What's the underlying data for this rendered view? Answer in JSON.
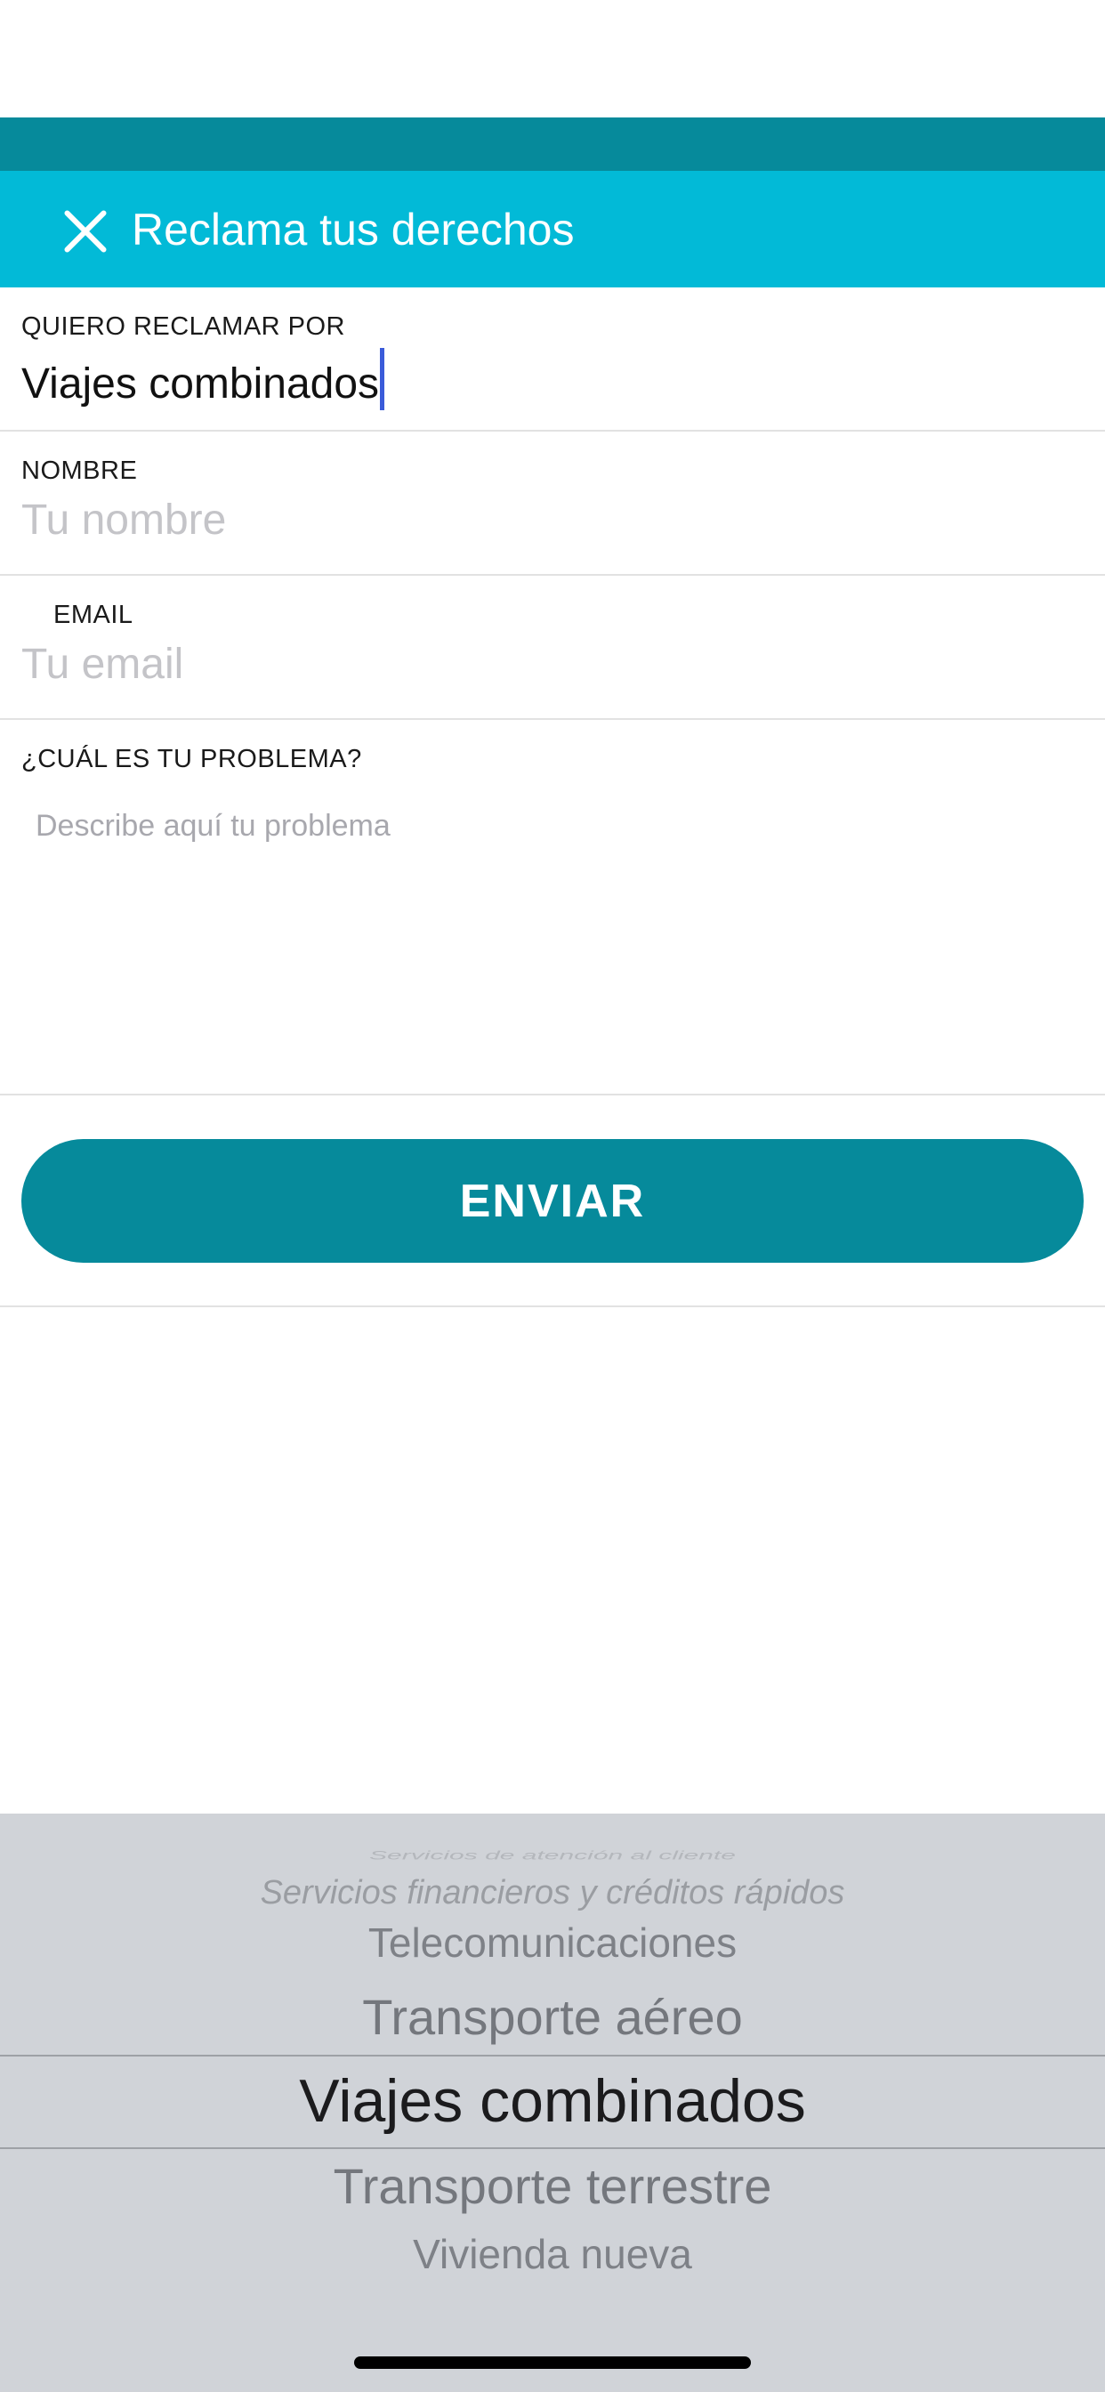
{
  "header": {
    "title": "Reclama tus derechos"
  },
  "form": {
    "category": {
      "label": "QUIERO RECLAMAR POR",
      "value": "Viajes combinados"
    },
    "name": {
      "label": "NOMBRE",
      "placeholder": "Tu nombre"
    },
    "email": {
      "label": "EMAIL",
      "placeholder": "Tu email"
    },
    "problem": {
      "label": "¿CUÁL ES TU PROBLEMA?",
      "placeholder": "Describe aquí tu problema"
    },
    "submit_label": "ENVIAR"
  },
  "picker": {
    "items": [
      "Servicios de atención al cliente",
      "Servicios financieros y créditos rápidos",
      "Telecomunicaciones",
      "Transporte aéreo",
      "Viajes combinados",
      "Transporte terrestre",
      "Vivienda nueva"
    ],
    "selected": "Viajes combinados"
  },
  "colors": {
    "header": "#02bad7",
    "status_band": "#068a9b",
    "button": "#068a9b",
    "caret": "#3a5bd9",
    "picker_background": "#d0d3d8"
  },
  "icons": {
    "close": "close-icon"
  }
}
